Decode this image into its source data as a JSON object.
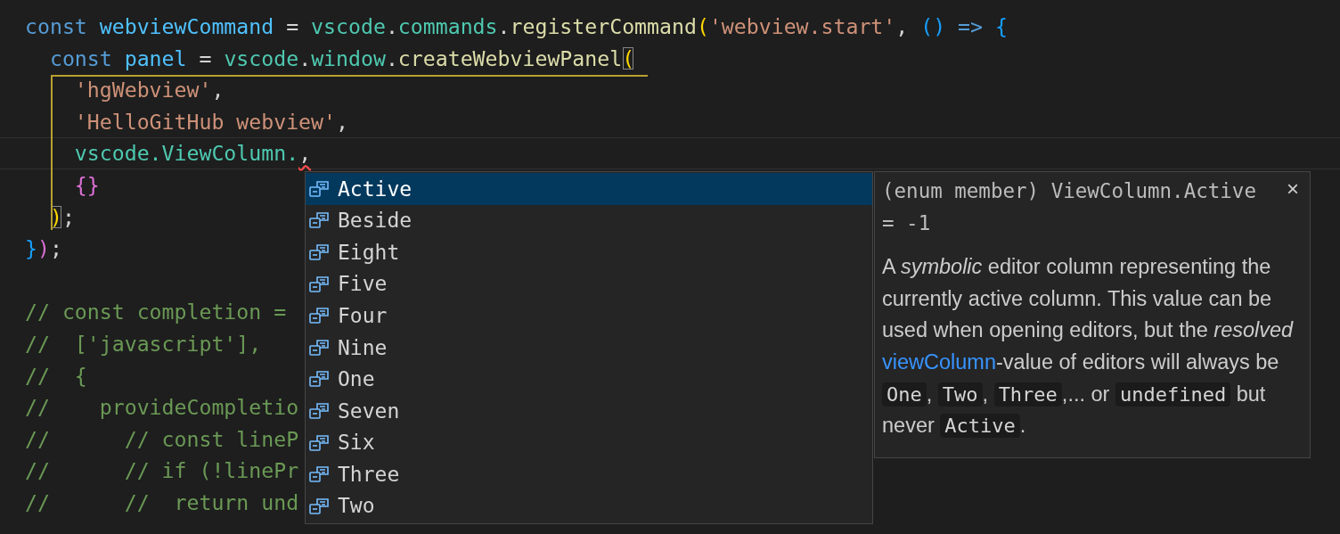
{
  "editor": {
    "lines": [
      {
        "current": false,
        "tokens": [
          {
            "t": "const ",
            "kind": "kw"
          },
          {
            "t": "webviewCommand",
            "kind": "var"
          },
          {
            "t": " = ",
            "kind": "punct"
          },
          {
            "t": "vscode",
            "kind": "ns"
          },
          {
            "t": ".",
            "kind": "punct"
          },
          {
            "t": "commands",
            "kind": "ns"
          },
          {
            "t": ".",
            "kind": "punct"
          },
          {
            "t": "registerCommand",
            "kind": "fn"
          },
          {
            "t": "(",
            "kind": "gold",
            "boxed": false
          },
          {
            "t": "'webview.start'",
            "kind": "str"
          },
          {
            "t": ", ",
            "kind": "punct"
          },
          {
            "t": "()",
            "kind": "blue"
          },
          {
            "t": " => ",
            "kind": "kw"
          },
          {
            "t": "{",
            "kind": "blue"
          }
        ]
      },
      {
        "current": false,
        "tokens": [
          {
            "t": "  const ",
            "kind": "kw"
          },
          {
            "t": "panel",
            "kind": "var"
          },
          {
            "t": " = ",
            "kind": "punct"
          },
          {
            "t": "vscode",
            "kind": "ns"
          },
          {
            "t": ".",
            "kind": "punct"
          },
          {
            "t": "window",
            "kind": "ns"
          },
          {
            "t": ".",
            "kind": "punct"
          },
          {
            "t": "createWebviewPanel",
            "kind": "fn"
          },
          {
            "t": "(",
            "kind": "gold",
            "boxed": true
          }
        ]
      },
      {
        "current": false,
        "tokens": [
          {
            "t": "    'hgWebview'",
            "kind": "str"
          },
          {
            "t": ",",
            "kind": "punct"
          }
        ]
      },
      {
        "current": false,
        "tokens": [
          {
            "t": "    'HelloGitHub webview'",
            "kind": "str"
          },
          {
            "t": ",",
            "kind": "punct"
          }
        ]
      },
      {
        "current": true,
        "tokens": [
          {
            "t": "    vscode.ViewColumn.",
            "kind": "ns"
          },
          {
            "t": ",",
            "kind": "punct",
            "error": true
          }
        ]
      },
      {
        "current": false,
        "tokens": [
          {
            "t": "    {}",
            "kind": "orchid"
          }
        ]
      },
      {
        "current": false,
        "tokens": [
          {
            "t": "  )",
            "kind": "gold",
            "boxed": true
          },
          {
            "t": ";",
            "kind": "punct"
          }
        ]
      },
      {
        "current": false,
        "tokens": [
          {
            "t": "}",
            "kind": "blue"
          },
          {
            "t": ")",
            "kind": "orchid"
          },
          {
            "t": ";",
            "kind": "punct"
          }
        ]
      },
      {
        "current": false
      },
      {
        "current": false,
        "tokens": [
          {
            "t": "// const completion =",
            "kind": "cmt"
          }
        ]
      },
      {
        "current": false,
        "tokens": [
          {
            "t": "//  ['javascript'],",
            "kind": "cmt"
          }
        ]
      },
      {
        "current": false,
        "tokens": [
          {
            "t": "//  {",
            "kind": "cmt"
          }
        ]
      },
      {
        "current": false,
        "tokens": [
          {
            "t": "//    provideCompletio",
            "kind": "cmt"
          }
        ]
      },
      {
        "current": false,
        "tokens": [
          {
            "t": "//      // const lineP",
            "kind": "cmt"
          }
        ]
      },
      {
        "current": false,
        "tokens": [
          {
            "t": "//      // if (!linePr",
            "kind": "cmt"
          }
        ]
      },
      {
        "current": false,
        "tokens": [
          {
            "t": "//      //  return und",
            "kind": "cmt"
          }
        ]
      }
    ]
  },
  "suggestions": [
    {
      "label": "Active",
      "selected": true
    },
    {
      "label": "Beside",
      "selected": false
    },
    {
      "label": "Eight",
      "selected": false
    },
    {
      "label": "Five",
      "selected": false
    },
    {
      "label": "Four",
      "selected": false
    },
    {
      "label": "Nine",
      "selected": false
    },
    {
      "label": "One",
      "selected": false
    },
    {
      "label": "Seven",
      "selected": false
    },
    {
      "label": "Six",
      "selected": false
    },
    {
      "label": "Three",
      "selected": false
    },
    {
      "label": "Two",
      "selected": false
    }
  ],
  "details": {
    "signature": "(enum member) ViewColumn.Active = -1",
    "close": "×",
    "body": [
      {
        "kind": "text",
        "text": "A *symbolic* editor column representing the currently active column. This value can be used when opening editors, but the *resolved*"
      },
      {
        "kind": "link",
        "text": "viewColumn"
      },
      {
        "kind": "text",
        "text": "-value of editors will always be"
      },
      {
        "kind": "code",
        "text": "One"
      },
      {
        "kind": "text",
        "text": ","
      },
      {
        "kind": "code",
        "text": "Two"
      },
      {
        "kind": "text",
        "text": ","
      },
      {
        "kind": "code",
        "text": "Three"
      },
      {
        "kind": "text",
        "text": ",... or"
      },
      {
        "kind": "code",
        "text": "undefined"
      },
      {
        "kind": "text",
        "text": "but never"
      },
      {
        "kind": "code",
        "text": "Active"
      },
      {
        "kind": "text",
        "text": "."
      }
    ]
  }
}
